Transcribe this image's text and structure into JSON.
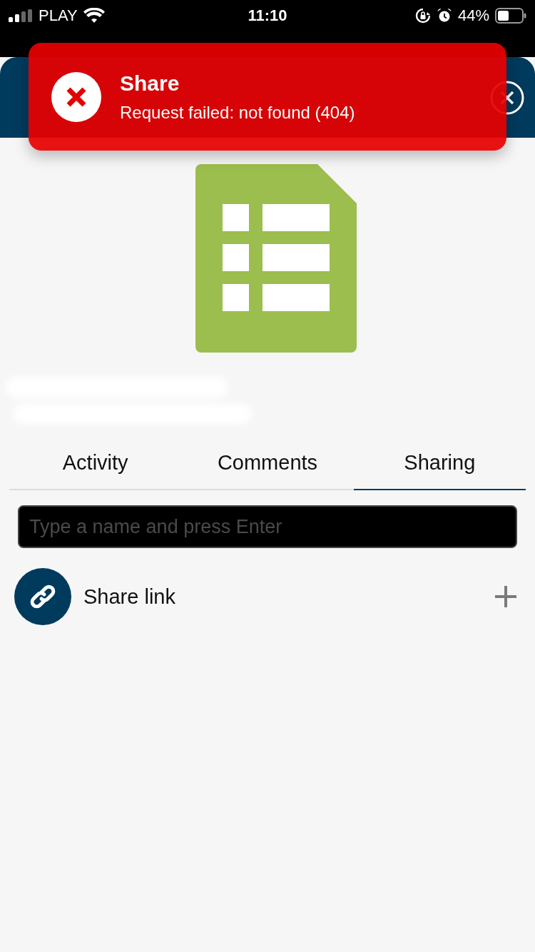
{
  "status_bar": {
    "carrier": "PLAY",
    "time": "11:10",
    "battery": "44%"
  },
  "toast": {
    "kind": "error",
    "title": "Share",
    "message": "Request failed: not found (404)"
  },
  "tabs": [
    {
      "label": "Activity",
      "selected": false
    },
    {
      "label": "Comments",
      "selected": false
    },
    {
      "label": "Sharing",
      "selected": true
    }
  ],
  "search": {
    "placeholder": "Type a name and press Enter"
  },
  "share_items": [
    {
      "label": "Share link"
    }
  ]
}
